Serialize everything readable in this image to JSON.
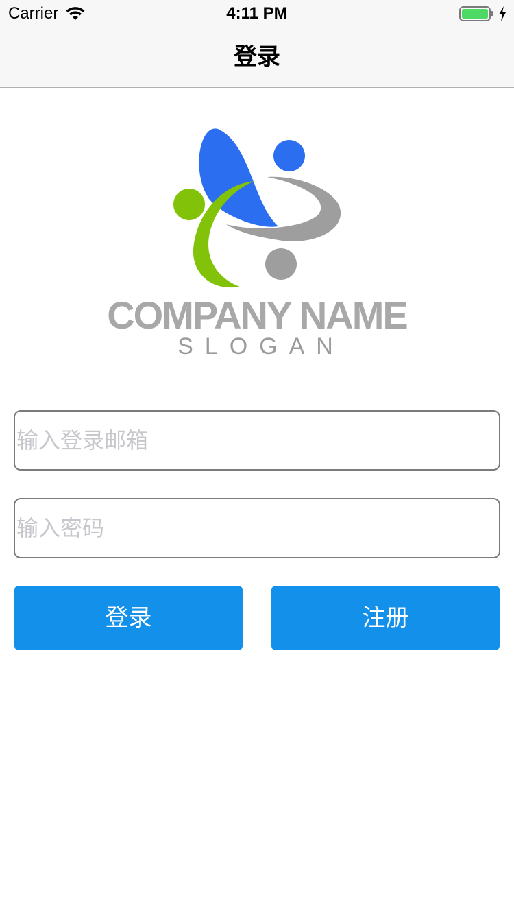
{
  "status_bar": {
    "carrier": "Carrier",
    "time": "4:11 PM",
    "icons": [
      "wifi-icon",
      "battery-icon",
      "charging-icon"
    ]
  },
  "nav": {
    "title": "登录"
  },
  "logo": {
    "company_name": "COMPANY NAME",
    "slogan": "SLOGAN",
    "colors": {
      "blue": "#2b6ff0",
      "green": "#82c30a",
      "gray": "#9e9e9e"
    }
  },
  "form": {
    "email_placeholder": "输入登录邮箱",
    "email_value": "",
    "password_placeholder": "输入密码",
    "password_value": ""
  },
  "buttons": {
    "login_label": "登录",
    "register_label": "注册"
  },
  "colors": {
    "accent": "#1390e9",
    "battery": "#4cd964"
  }
}
